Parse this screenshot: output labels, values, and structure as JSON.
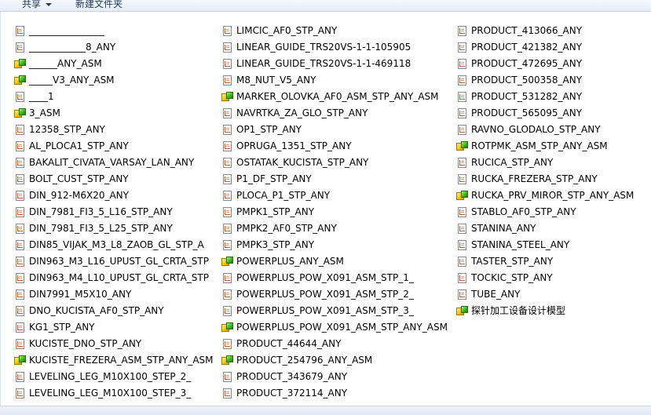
{
  "toolbar": {
    "share_label": "共享",
    "new_folder_label": "新建文件夹"
  },
  "columns": [
    {
      "items": [
        {
          "name": "________________",
          "type": "doc"
        },
        {
          "name": "____________8_ANY",
          "type": "doc"
        },
        {
          "name": "______ANY_ASM",
          "type": "asm"
        },
        {
          "name": "_____V3_ANY_ASM",
          "type": "asm"
        },
        {
          "name": "____1",
          "type": "doc"
        },
        {
          "name": "3_ASM",
          "type": "asm"
        },
        {
          "name": "12358_STP_ANY",
          "type": "doc"
        },
        {
          "name": "AL_PLOCA1_STP_ANY",
          "type": "doc"
        },
        {
          "name": "BAKALIT_CIVATA_VARSAY_LAN_ANY",
          "type": "doc"
        },
        {
          "name": "BOLT_CUST_STP_ANY",
          "type": "doc"
        },
        {
          "name": "DIN_912-M6X20_ANY",
          "type": "doc"
        },
        {
          "name": "DIN_7981_FI3_5_L16_STP_ANY",
          "type": "doc"
        },
        {
          "name": "DIN_7981_FI3_5_L25_STP_ANY",
          "type": "doc"
        },
        {
          "name": "DIN85_VIJAK_M3_L8_ZAOB_GL_STP_A",
          "type": "doc"
        },
        {
          "name": "DIN963_M3_L16_UPUST_GL_CRTA_STP",
          "type": "doc"
        },
        {
          "name": "DIN963_M4_L10_UPUST_GL_CRTA_STP",
          "type": "doc"
        },
        {
          "name": "DIN7991_M5X10_ANY",
          "type": "doc"
        },
        {
          "name": "DNO_KUCISTA_AF0_STP_ANY",
          "type": "doc"
        },
        {
          "name": "KG1_STP_ANY",
          "type": "doc"
        },
        {
          "name": "KUCISTE_DNO_STP_ANY",
          "type": "doc"
        },
        {
          "name": "KUCISTE_FREZERA_ASM_STP_ANY_ASM",
          "type": "asm"
        },
        {
          "name": "LEVELING_LEG_M10X100_STEP_2_",
          "type": "doc"
        },
        {
          "name": "LEVELING_LEG_M10X100_STEP_3_",
          "type": "doc"
        }
      ]
    },
    {
      "items": [
        {
          "name": "LIMCIC_AF0_STP_ANY",
          "type": "doc"
        },
        {
          "name": "LINEAR_GUIDE_TRS20VS-1-1-105905",
          "type": "doc"
        },
        {
          "name": "LINEAR_GUIDE_TRS20VS-1-1-469118",
          "type": "doc"
        },
        {
          "name": "M8_NUT_V5_ANY",
          "type": "doc"
        },
        {
          "name": "MARKER_OLOVKA_AF0_ASM_STP_ANY_ASM",
          "type": "asm"
        },
        {
          "name": "NAVRTKA_ZA_GLO_STP_ANY",
          "type": "doc"
        },
        {
          "name": "OP1_STP_ANY",
          "type": "doc"
        },
        {
          "name": "OPRUGA_1351_STP_ANY",
          "type": "doc"
        },
        {
          "name": "OSTATAK_KUCISTA_STP_ANY",
          "type": "doc"
        },
        {
          "name": "P1_DF_STP_ANY",
          "type": "doc"
        },
        {
          "name": "PLOCA_P1_STP_ANY",
          "type": "doc"
        },
        {
          "name": "PMPK1_STP_ANY",
          "type": "doc"
        },
        {
          "name": "PMPK2_AF0_STP_ANY",
          "type": "doc"
        },
        {
          "name": "PMPK3_STP_ANY",
          "type": "doc"
        },
        {
          "name": "POWERPLUS_ANY_ASM",
          "type": "asm"
        },
        {
          "name": "POWERPLUS_POW_X091_ASM_STP_1_",
          "type": "doc"
        },
        {
          "name": "POWERPLUS_POW_X091_ASM_STP_2_",
          "type": "doc"
        },
        {
          "name": "POWERPLUS_POW_X091_ASM_STP_3_",
          "type": "doc"
        },
        {
          "name": "POWERPLUS_POW_X091_ASM_STP_ANY_ASM",
          "type": "asm"
        },
        {
          "name": "PRODUCT_44644_ANY",
          "type": "doc"
        },
        {
          "name": "PRODUCT_254796_ANY_ASM",
          "type": "asm"
        },
        {
          "name": "PRODUCT_343679_ANY",
          "type": "doc"
        },
        {
          "name": "PRODUCT_372114_ANY",
          "type": "doc"
        }
      ]
    },
    {
      "items": [
        {
          "name": "PRODUCT_413066_ANY",
          "type": "doc"
        },
        {
          "name": "PRODUCT_421382_ANY",
          "type": "doc"
        },
        {
          "name": "PRODUCT_472695_ANY",
          "type": "doc"
        },
        {
          "name": "PRODUCT_500358_ANY",
          "type": "doc"
        },
        {
          "name": "PRODUCT_531282_ANY",
          "type": "doc"
        },
        {
          "name": "PRODUCT_565095_ANY",
          "type": "doc"
        },
        {
          "name": "RAVNO_GLODALO_STP_ANY",
          "type": "doc"
        },
        {
          "name": "ROTPMK_ASM_STP_ANY_ASM",
          "type": "asm"
        },
        {
          "name": "RUCICA_STP_ANY",
          "type": "doc"
        },
        {
          "name": "RUCKA_FREZERA_STP_ANY",
          "type": "doc"
        },
        {
          "name": "RUCKA_PRV_MIROR_STP_ANY_ASM",
          "type": "asm"
        },
        {
          "name": "STABLO_AF0_STP_ANY",
          "type": "doc"
        },
        {
          "name": "STANINA_ANY",
          "type": "doc"
        },
        {
          "name": "STANINA_STEEL_ANY",
          "type": "doc"
        },
        {
          "name": "TASTER_STP_ANY",
          "type": "doc"
        },
        {
          "name": "TOCKIC_STP_ANY",
          "type": "doc"
        },
        {
          "name": "TUBE_ANY",
          "type": "doc"
        },
        {
          "name": "探针加工设备设计模型",
          "type": "asm"
        }
      ]
    }
  ],
  "icons": {
    "doc": "step-file-icon",
    "asm": "assembly-icon"
  }
}
